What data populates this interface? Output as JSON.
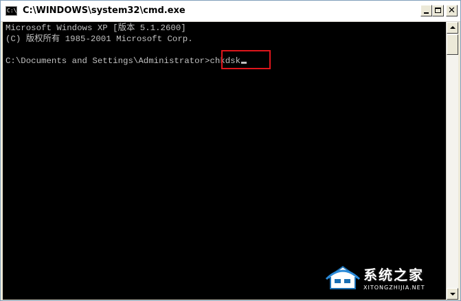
{
  "window": {
    "title": "C:\\WINDOWS\\system32\\cmd.exe",
    "icon": "C:\\",
    "minimize_icon": "minimize-icon",
    "maximize_icon": "maximize-icon",
    "close_label": "✕"
  },
  "console": {
    "lines": [
      "Microsoft Windows XP [版本 5.1.2600]",
      "(C) 版权所有 1985-2001 Microsoft Corp.",
      "",
      "C:\\Documents and Settings\\Administrator>"
    ],
    "command": "chkdsk",
    "text_color": "#c0c0c0",
    "background_color": "#000000",
    "highlight_color": "#e0161c"
  },
  "watermark": {
    "name": "系统之家",
    "url": "XITONGZHIJIA.NET"
  }
}
